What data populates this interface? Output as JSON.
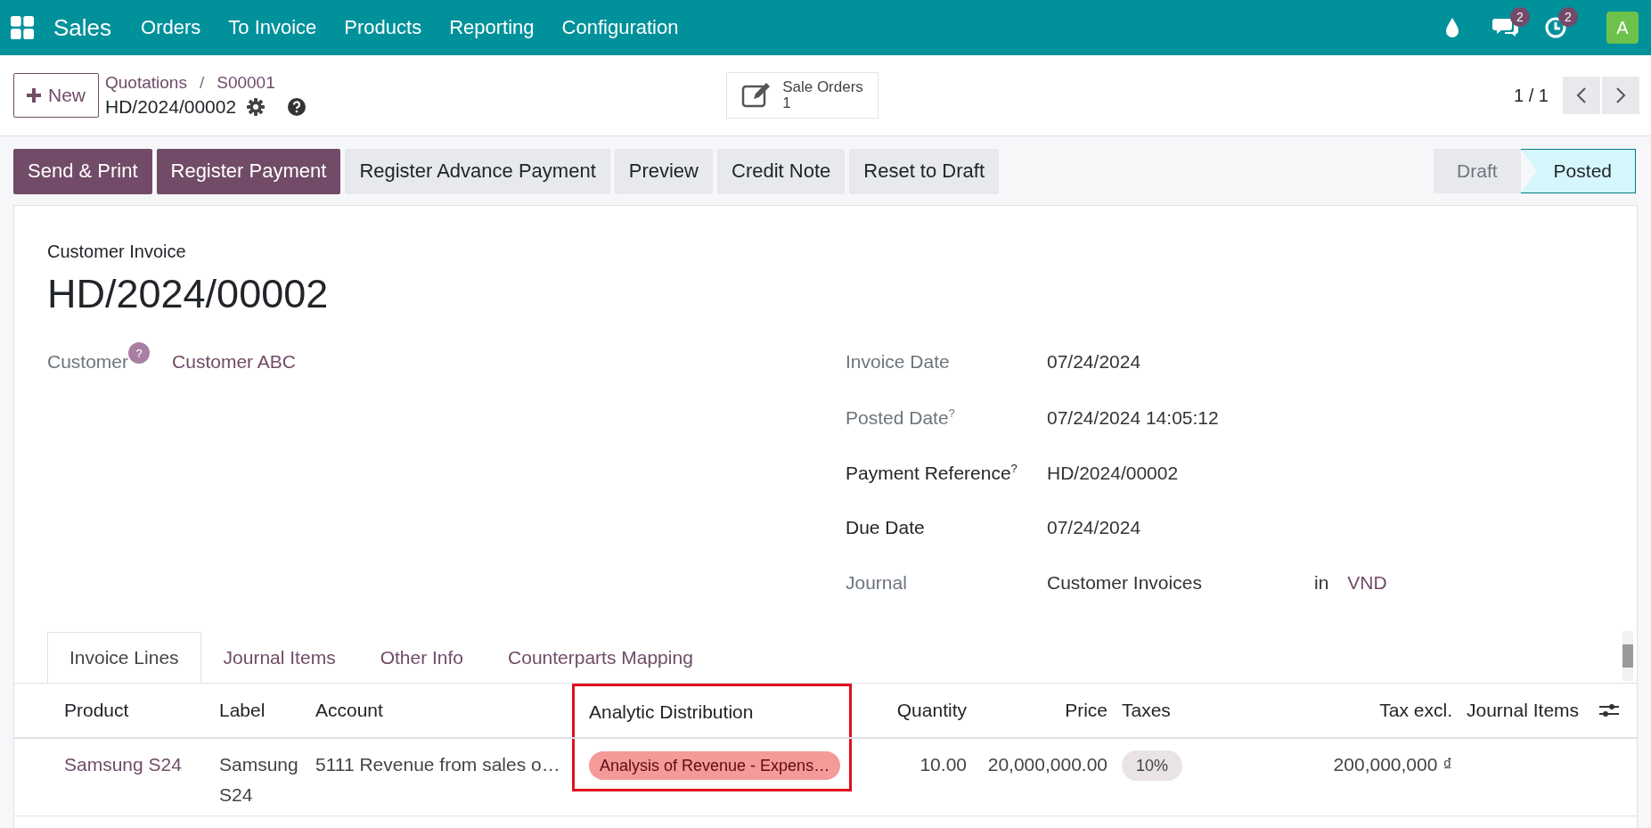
{
  "navbar": {
    "app": "Sales",
    "menu": [
      "Orders",
      "To Invoice",
      "Products",
      "Reporting",
      "Configuration"
    ],
    "messages_count": "2",
    "activities_count": "2",
    "avatar": "A"
  },
  "control_panel": {
    "new_button": "New",
    "breadcrumbs": [
      "Quotations",
      "S00001"
    ],
    "breadcrumb_separator": "/",
    "record": "HD/2024/00002",
    "smart_button": {
      "label": "Sale Orders",
      "count": "1"
    },
    "pager": "1 / 1"
  },
  "actions": [
    {
      "label": "Send & Print",
      "kind": "primary"
    },
    {
      "label": "Register Payment",
      "kind": "primary"
    },
    {
      "label": "Register Advance Payment",
      "kind": "secondary"
    },
    {
      "label": "Preview",
      "kind": "secondary"
    },
    {
      "label": "Credit Note",
      "kind": "secondary"
    },
    {
      "label": "Reset to Draft",
      "kind": "secondary"
    }
  ],
  "status_bar": [
    {
      "label": "Draft",
      "selected": false
    },
    {
      "label": "Posted",
      "selected": true
    }
  ],
  "form": {
    "type_label": "Customer Invoice",
    "title": "HD/2024/00002",
    "customer": {
      "label": "Customer",
      "help": "?",
      "value": "Customer ABC"
    },
    "fields": [
      {
        "label": "Invoice Date",
        "required": false,
        "value": "07/24/2024"
      },
      {
        "label": "Posted Date",
        "help": "?",
        "required": false,
        "value": "07/24/2024 14:05:12"
      },
      {
        "label": "Payment Reference",
        "help": "?",
        "required": true,
        "value": "HD/2024/00002"
      },
      {
        "label": "Due Date",
        "required": true,
        "value": "07/24/2024"
      },
      {
        "label": "Journal",
        "required": false,
        "value": "Customer Invoices",
        "joiner": "in",
        "currency": "VND"
      }
    ]
  },
  "tabs": [
    {
      "label": "Invoice Lines",
      "selected": true
    },
    {
      "label": "Journal Items",
      "selected": false
    },
    {
      "label": "Other Info",
      "selected": false
    },
    {
      "label": "Counterparts Mapping",
      "selected": false
    }
  ],
  "table": {
    "columns": [
      {
        "label": "Product",
        "kind": "text",
        "highlighted": false
      },
      {
        "label": "Label",
        "kind": "text",
        "highlighted": false
      },
      {
        "label": "Account",
        "kind": "text",
        "highlighted": false
      },
      {
        "label": "Analytic Distribution",
        "kind": "text",
        "highlighted": true
      },
      {
        "label": "Quantity",
        "kind": "number",
        "highlighted": false
      },
      {
        "label": "Price",
        "kind": "number",
        "highlighted": false
      },
      {
        "label": "Taxes",
        "kind": "text",
        "highlighted": false
      },
      {
        "label": "Tax excl.",
        "kind": "number",
        "highlighted": false
      },
      {
        "label": "Journal Items",
        "kind": "text",
        "highlighted": false
      }
    ],
    "rows": [
      {
        "cells": [
          {
            "kind": "link",
            "text": "Samsung S24"
          },
          {
            "kind": "text",
            "text": "Samsung S24"
          },
          {
            "kind": "text",
            "text": "5111 Revenue from sales o…"
          },
          {
            "kind": "tag",
            "text": "Analysis of Revenue - Expens…"
          },
          {
            "kind": "text",
            "text": "10.00"
          },
          {
            "kind": "text",
            "text": "20,000,000.00"
          },
          {
            "kind": "pill",
            "text": "10%"
          },
          {
            "kind": "money",
            "text": "200,000,000 ₫"
          }
        ]
      }
    ]
  }
}
